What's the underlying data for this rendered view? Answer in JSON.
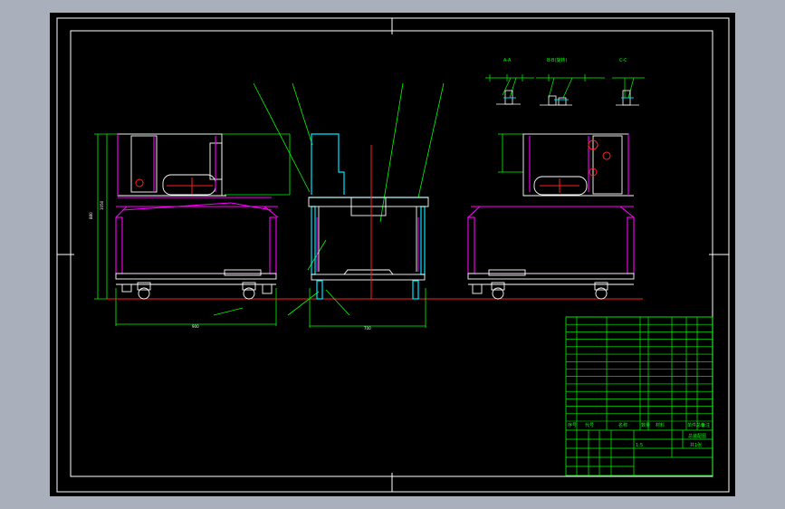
{
  "colors": {
    "background": "#000000",
    "frame": "#ffffff",
    "outline_green": "#00ff00",
    "part_magenta": "#ff00ff",
    "part_cyan": "#00e5ff",
    "center_red": "#ff2020",
    "part_white": "#ffffff",
    "chrome_blue_gray": "#aab0bb"
  },
  "section_labels": [
    "A-A",
    "B-B(旋转)",
    "C-C"
  ],
  "table": {
    "header": {
      "no": "序号",
      "code": "代号",
      "name": "名称",
      "qty": "数量",
      "material": "材料",
      "mass": "单件总计",
      "remark": "备注"
    },
    "row_count": 14,
    "title_block": {
      "drawing_name": "总装配图",
      "scale": "1:5",
      "sheet": "共1张"
    }
  }
}
